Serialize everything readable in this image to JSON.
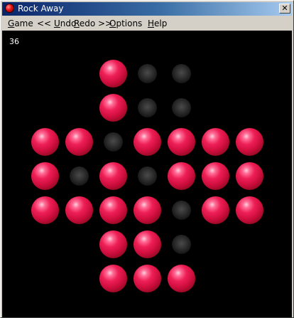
{
  "window": {
    "title": "Rock Away",
    "close_glyph": "✕"
  },
  "menu": [
    {
      "key": "G",
      "rest": "ame"
    },
    {
      "prefix": "<< ",
      "key": "U",
      "rest": "ndo"
    },
    {
      "key": "R",
      "rest": "edo >>"
    },
    {
      "key": "O",
      "rest": "ptions"
    },
    {
      "key": "H",
      "rest": "elp"
    }
  ],
  "game": {
    "peg_count": "36",
    "peg_color": "#e8184a",
    "hole_color": "#2a2a2a",
    "board": [
      [
        "-",
        "-",
        "P",
        "H",
        "H",
        "-",
        "-"
      ],
      [
        "-",
        "-",
        "P",
        "H",
        "H",
        "-",
        "-"
      ],
      [
        "P",
        "P",
        "H",
        "P",
        "P",
        "P",
        "P"
      ],
      [
        "P",
        "H",
        "P",
        "H",
        "P",
        "P",
        "P"
      ],
      [
        "P",
        "P",
        "P",
        "P",
        "H",
        "P",
        "P"
      ],
      [
        "-",
        "-",
        "P",
        "P",
        "H",
        "-",
        "-"
      ],
      [
        "-",
        "-",
        "P",
        "P",
        "P",
        "-",
        "-"
      ]
    ]
  }
}
